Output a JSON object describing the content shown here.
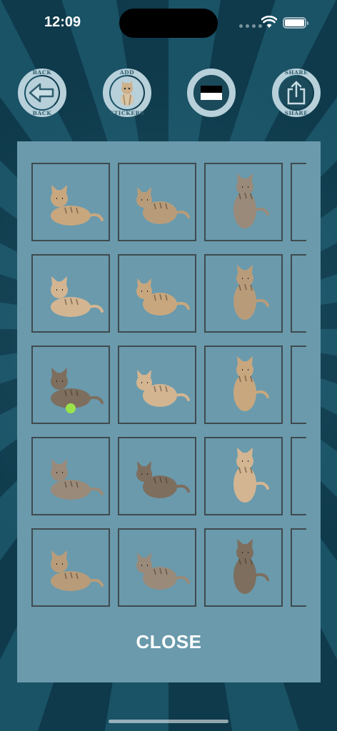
{
  "status_bar": {
    "time": "12:09"
  },
  "toolbar": {
    "back": {
      "label_top": "BACK",
      "label_bottom": "BACK",
      "icon": "back-arrow-icon"
    },
    "add_stickers": {
      "label_top": "ADD",
      "label_bottom": "STICKERS",
      "icon": "kitten-icon"
    },
    "middle": {
      "icon": "flag-icon"
    },
    "share": {
      "label_top": "SHARE",
      "label_bottom": "SHARE",
      "icon": "share-icon"
    }
  },
  "stickers": {
    "rows": 5,
    "columns": 4,
    "items": [
      {
        "pose": "two-kittens-playing"
      },
      {
        "pose": "kitten-crouching-paw-up"
      },
      {
        "pose": "kitten-standing-hind-legs"
      },
      {
        "pose": "partial"
      },
      {
        "pose": "kitten-walking"
      },
      {
        "pose": "two-kittens-sitting"
      },
      {
        "pose": "kitten-sitting-looking-up"
      },
      {
        "pose": "partial"
      },
      {
        "pose": "kitten-with-yarn-ball"
      },
      {
        "pose": "kitten-crouching"
      },
      {
        "pose": "kitten-jumping"
      },
      {
        "pose": "partial"
      },
      {
        "pose": "kitten-lying"
      },
      {
        "pose": "kitten-rolling"
      },
      {
        "pose": "kitten-sitting-front"
      },
      {
        "pose": "partial"
      },
      {
        "pose": "kitten-sitting-face"
      },
      {
        "pose": "kitten-licking-paw"
      },
      {
        "pose": "kitten-sitting-side"
      },
      {
        "pose": "partial"
      }
    ]
  },
  "close_label": "CLOSE",
  "colors": {
    "panel": "#6a9aac",
    "cell_border": "#3f4a4e",
    "button_ring": "#b7d0da",
    "background": "#0f3b4c"
  }
}
